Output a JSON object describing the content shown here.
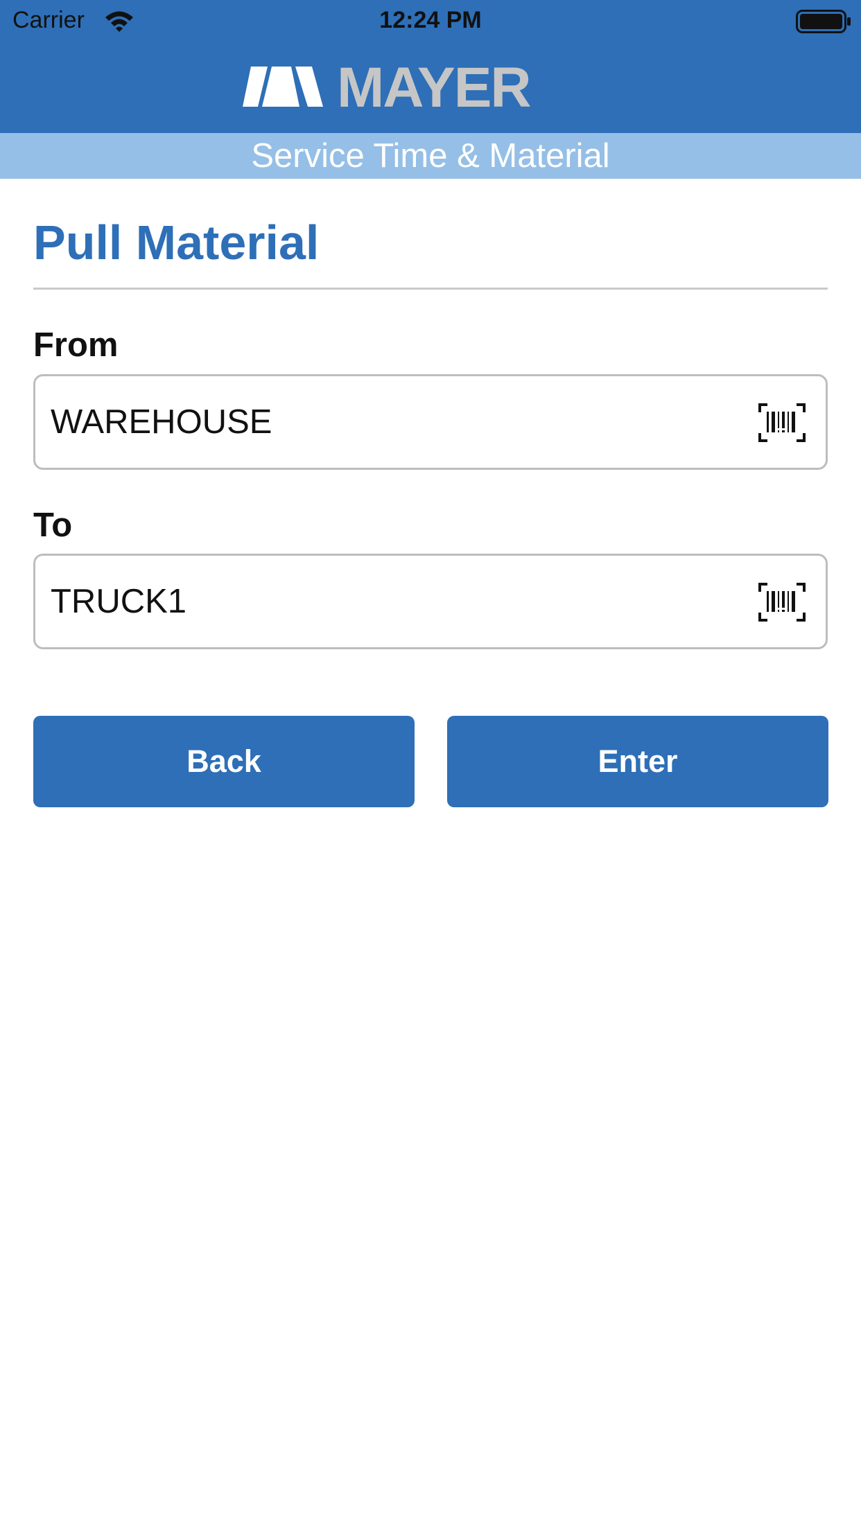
{
  "status_bar": {
    "carrier": "Carrier",
    "time": "12:24 PM"
  },
  "header": {
    "logo_text": "MAYER",
    "subtitle": "Service Time & Material",
    "colors": {
      "primary": "#2e6fb7",
      "band": "#95bfe6",
      "logo": "#c6c6c6"
    }
  },
  "page": {
    "title": "Pull Material"
  },
  "form": {
    "from": {
      "label": "From",
      "value": "WAREHOUSE",
      "icon": "barcode-scan-icon"
    },
    "to": {
      "label": "To",
      "value": "TRUCK1",
      "icon": "barcode-scan-icon"
    }
  },
  "actions": {
    "back_label": "Back",
    "enter_label": "Enter"
  }
}
